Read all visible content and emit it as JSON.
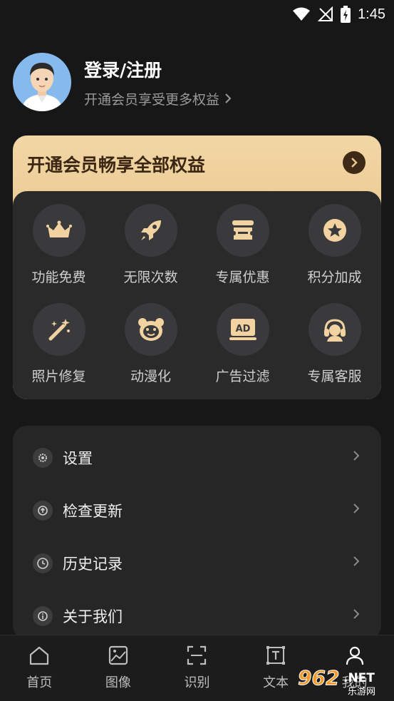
{
  "status_bar": {
    "time": "1:45"
  },
  "profile": {
    "title": "登录/注册",
    "subtitle": "开通会员享受更多权益"
  },
  "vip": {
    "title": "开通会员畅享全部权益",
    "benefits": [
      {
        "label": "功能免费",
        "icon": "crown-icon"
      },
      {
        "label": "无限次数",
        "icon": "rocket-icon"
      },
      {
        "label": "专属优惠",
        "icon": "ticket-icon"
      },
      {
        "label": "积分加成",
        "icon": "star-icon"
      },
      {
        "label": "照片修复",
        "icon": "magic-wand-icon"
      },
      {
        "label": "动漫化",
        "icon": "bear-icon"
      },
      {
        "label": "广告过滤",
        "icon": "ad-icon"
      },
      {
        "label": "专属客服",
        "icon": "headset-icon"
      }
    ]
  },
  "menu": {
    "items": [
      {
        "label": "设置",
        "icon": "gear-icon"
      },
      {
        "label": "检查更新",
        "icon": "update-icon"
      },
      {
        "label": "历史记录",
        "icon": "clock-icon"
      },
      {
        "label": "关于我们",
        "icon": "info-icon"
      }
    ]
  },
  "bottom_nav": {
    "items": [
      {
        "label": "首页",
        "icon": "home-icon"
      },
      {
        "label": "图像",
        "icon": "image-icon"
      },
      {
        "label": "识别",
        "icon": "scan-icon"
      },
      {
        "label": "文本",
        "icon": "text-icon"
      },
      {
        "label": "我的",
        "icon": "person-icon"
      }
    ]
  },
  "watermark": {
    "text": "962.NET",
    "sub": "乐游网"
  },
  "colors": {
    "background": "#171717",
    "vip_gold": "#e9c88f",
    "vip_text": "#3b2713",
    "card": "#262626"
  }
}
